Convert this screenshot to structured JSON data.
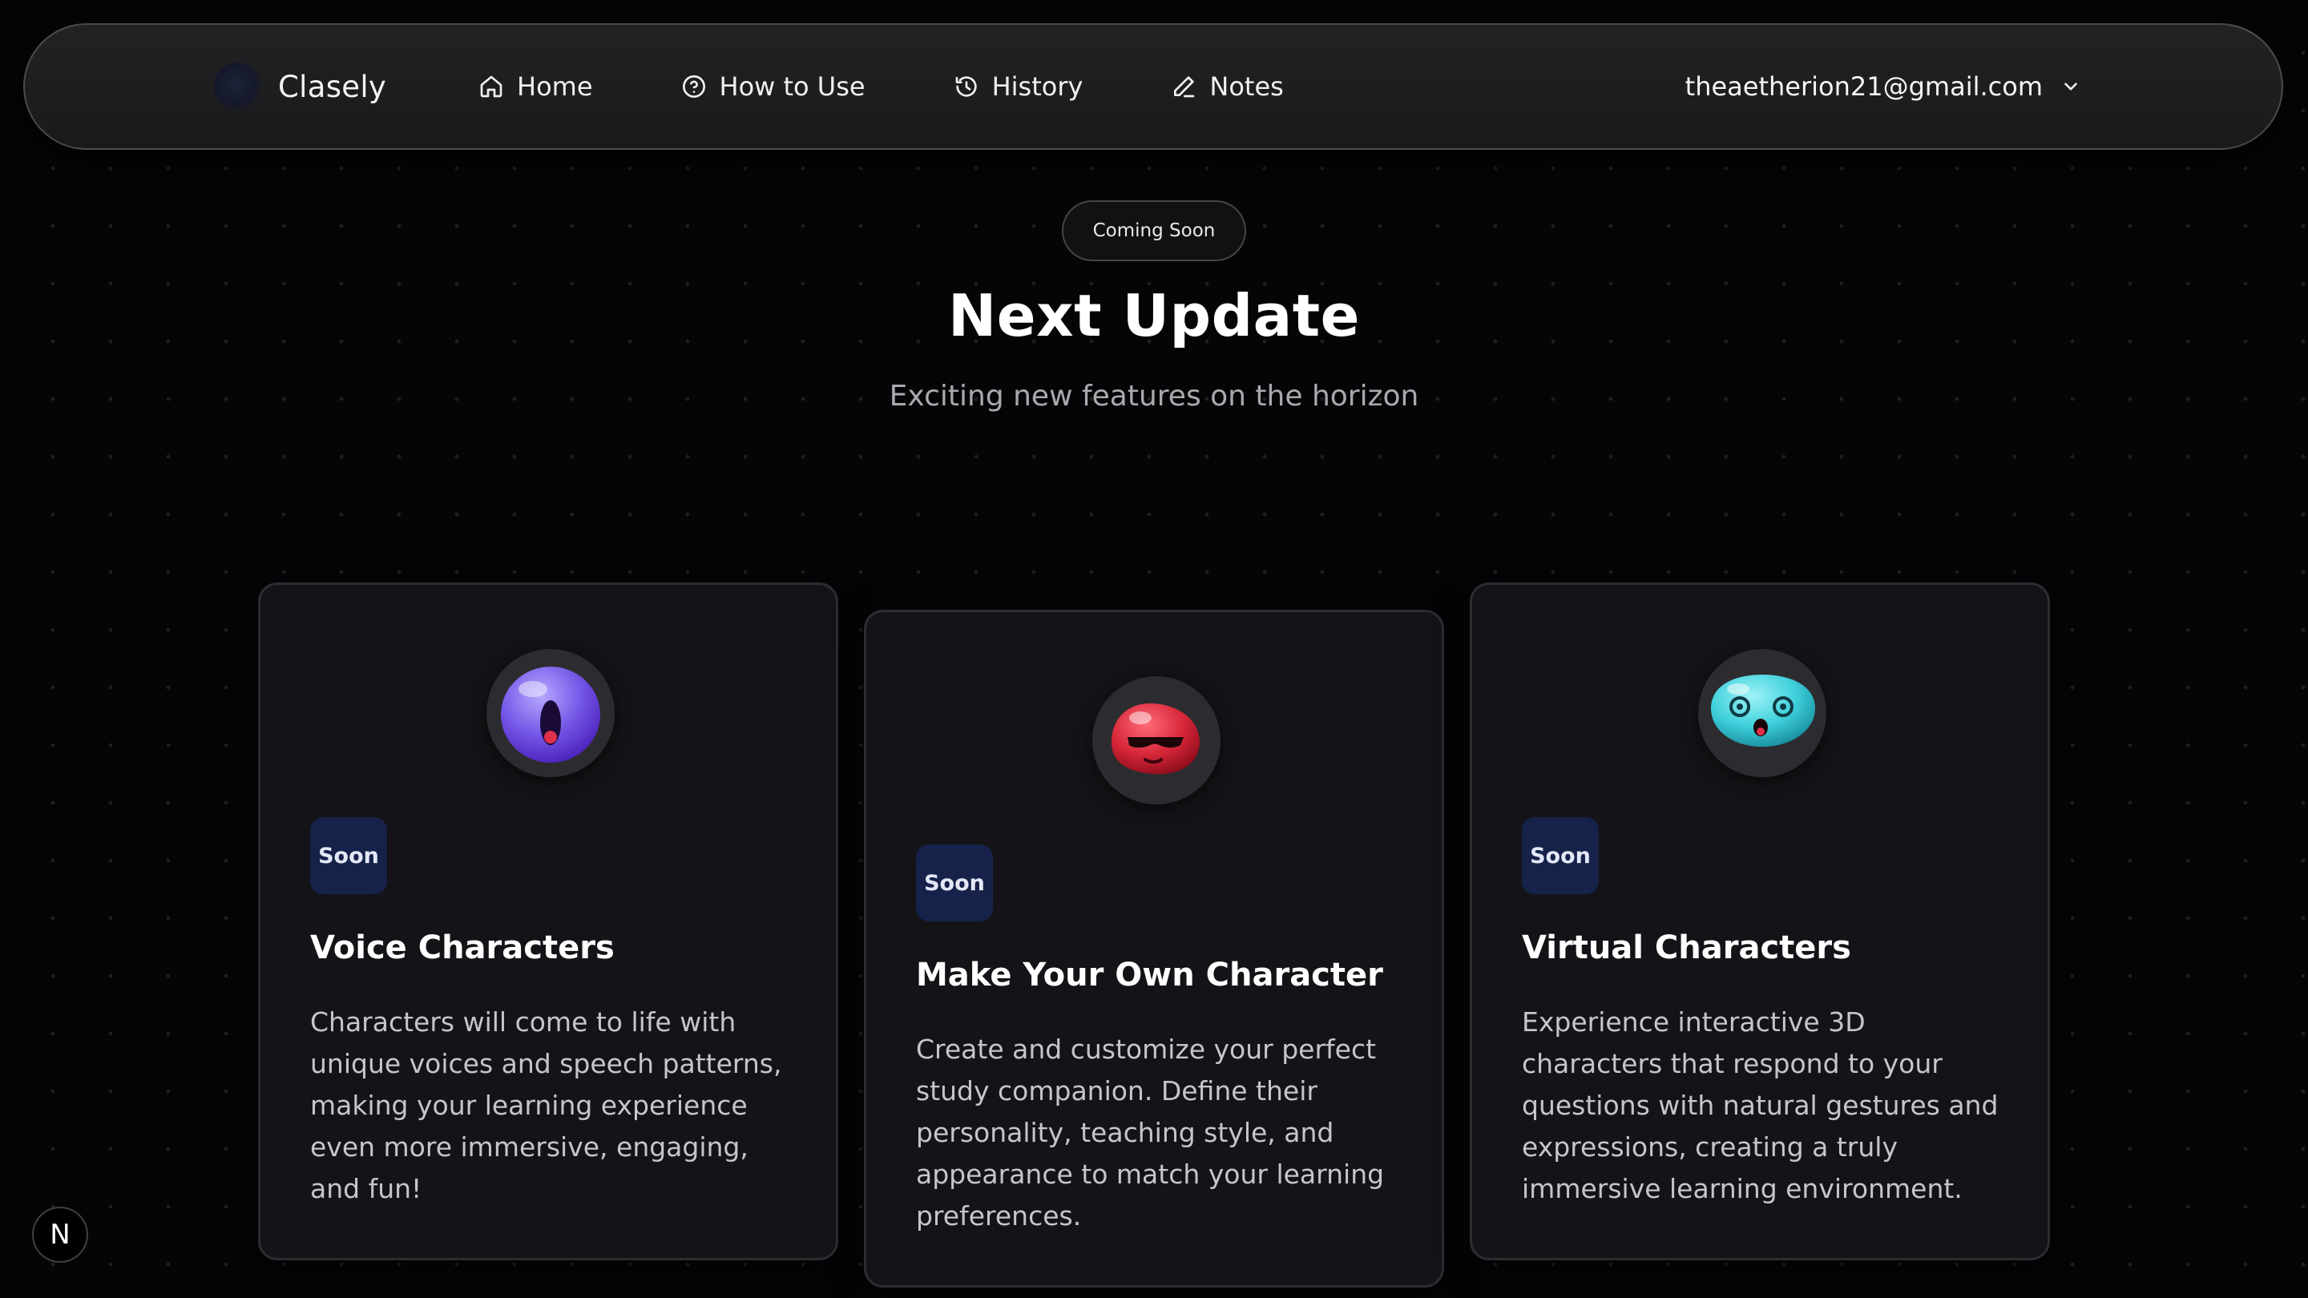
{
  "brand": {
    "name": "Clasely"
  },
  "nav": {
    "items": [
      {
        "label": "Home",
        "icon": "home-icon"
      },
      {
        "label": "How to Use",
        "icon": "help-circle-icon"
      },
      {
        "label": "History",
        "icon": "history-icon"
      },
      {
        "label": "Notes",
        "icon": "pencil-icon"
      }
    ],
    "account_email": "theaetherion21@gmail.com"
  },
  "hero": {
    "badge": "Coming Soon",
    "title": "Next Update",
    "subtitle": "Exciting new features on the horizon"
  },
  "cards": [
    {
      "badge": "Soon",
      "title": "Voice Characters",
      "description": "Characters will come to life with unique voices and speech patterns, making your learning experience even more immersive, engaging, and fun!",
      "avatar": "purple-surprised-blob-icon",
      "avatar_color": "#7b5ce0"
    },
    {
      "badge": "Soon",
      "title": "Make Your Own Character",
      "description": "Create and customize your perfect study companion. Define their personality, teaching style, and appearance to match your learning preferences.",
      "avatar": "red-sunglasses-blob-icon",
      "avatar_color": "#d8283a"
    },
    {
      "badge": "Soon",
      "title": "Virtual Characters",
      "description": "Experience interactive 3D characters that respond to your questions with natural gestures and expressions, creating a truly immersive learning environment.",
      "avatar": "cyan-dizzy-blob-icon",
      "avatar_color": "#3fd0dc"
    }
  ],
  "corner_button": {
    "label": "N"
  },
  "colors": {
    "background": "#050507",
    "card_background": "#141418",
    "soon_badge": "#16224a"
  }
}
